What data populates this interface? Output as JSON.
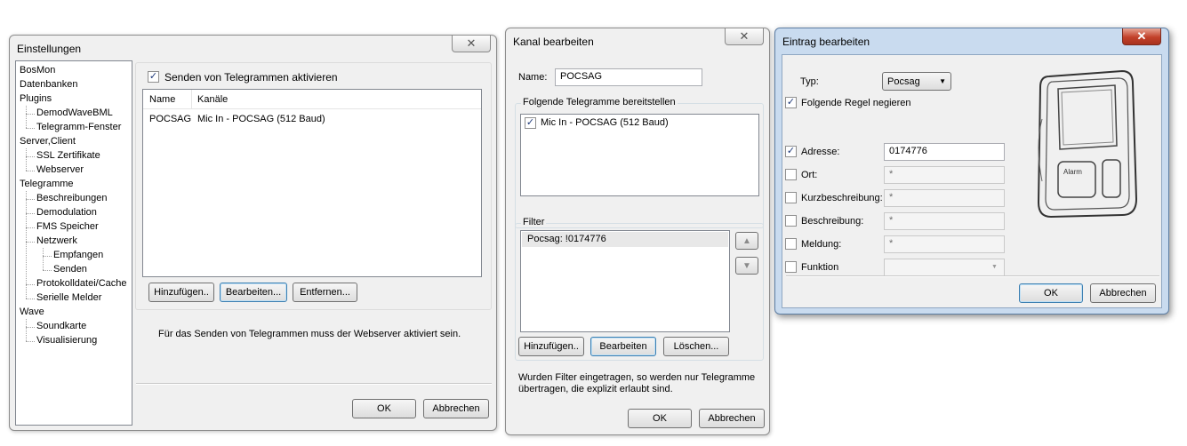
{
  "settings": {
    "title": "Einstellungen",
    "close": "✕",
    "tree": [
      {
        "label": "BosMon",
        "level": 0
      },
      {
        "label": "Datenbanken",
        "level": 0
      },
      {
        "label": "Plugins",
        "level": 0
      },
      {
        "label": "DemodWaveBML",
        "level": 1
      },
      {
        "label": "Telegramm-Fenster",
        "level": 1
      },
      {
        "label": "Server,Client",
        "level": 0
      },
      {
        "label": "SSL Zertifikate",
        "level": 1
      },
      {
        "label": "Webserver",
        "level": 1
      },
      {
        "label": "Telegramme",
        "level": 0
      },
      {
        "label": "Beschreibungen",
        "level": 1
      },
      {
        "label": "Demodulation",
        "level": 1
      },
      {
        "label": "FMS Speicher",
        "level": 1
      },
      {
        "label": "Netzwerk",
        "level": 1
      },
      {
        "label": "Empfangen",
        "level": 2
      },
      {
        "label": "Senden",
        "level": 2
      },
      {
        "label": "Protokolldatei/Cache",
        "level": 1
      },
      {
        "label": "Serielle Melder",
        "level": 1
      },
      {
        "label": "Wave",
        "level": 0
      },
      {
        "label": "Soundkarte",
        "level": 1
      },
      {
        "label": "Visualisierung",
        "level": 1
      }
    ],
    "enable_label": "Senden von Telegrammen aktivieren",
    "enable_checked": "✓",
    "columns": [
      "Name",
      "Kanäle"
    ],
    "rows": [
      [
        "POCSAG",
        "Mic In - POCSAG (512 Baud)"
      ]
    ],
    "btn_add": "Hinzufügen..",
    "btn_edit": "Bearbeiten...",
    "btn_remove": "Entfernen...",
    "info": "Für das Senden von Telegrammen muss der Webserver aktiviert sein.",
    "ok": "OK",
    "cancel": "Abbrechen"
  },
  "channel": {
    "title": "Kanal bearbeiten",
    "close": "✕",
    "name_label": "Name:",
    "name_value": "POCSAG",
    "provide_label": "Folgende Telegramme bereitstellen",
    "provide_items": [
      {
        "label": "Mic In - POCSAG (512 Baud)",
        "check": "✓"
      }
    ],
    "filter_label": "Filter",
    "filter_items": [
      "Pocsag: !0174776"
    ],
    "up_arrow": "▲",
    "down_arrow": "▼",
    "btn_add": "Hinzufügen..",
    "btn_edit": "Bearbeiten",
    "btn_delete": "Löschen...",
    "info": "Wurden Filter eingetragen, so werden nur Telegramme übertragen, die explizit erlaubt sind.",
    "ok": "OK",
    "cancel": "Abbrechen"
  },
  "entry": {
    "title": "Eintrag bearbeiten",
    "close": "✕",
    "typ_label": "Typ:",
    "typ_value": "Pocsag",
    "dropdown_arrow": "▼",
    "negate_label": "Folgende Regel negieren",
    "fields": [
      {
        "label": "Adresse:",
        "value": "0174776",
        "check": "✓",
        "enabled": true
      },
      {
        "label": "Ort:",
        "value": "*",
        "check": "",
        "enabled": false
      },
      {
        "label": "Kurzbeschreibung:",
        "value": "*",
        "check": "",
        "enabled": false
      },
      {
        "label": "Beschreibung:",
        "value": "*",
        "check": "",
        "enabled": false
      },
      {
        "label": "Meldung:",
        "value": "*",
        "check": "",
        "enabled": false
      },
      {
        "label": "Funktion",
        "value": "",
        "check": "",
        "enabled": false
      }
    ],
    "pager_text": "Alarm",
    "ok": "OK",
    "cancel": "Abbrechen",
    "checked": "✓"
  }
}
